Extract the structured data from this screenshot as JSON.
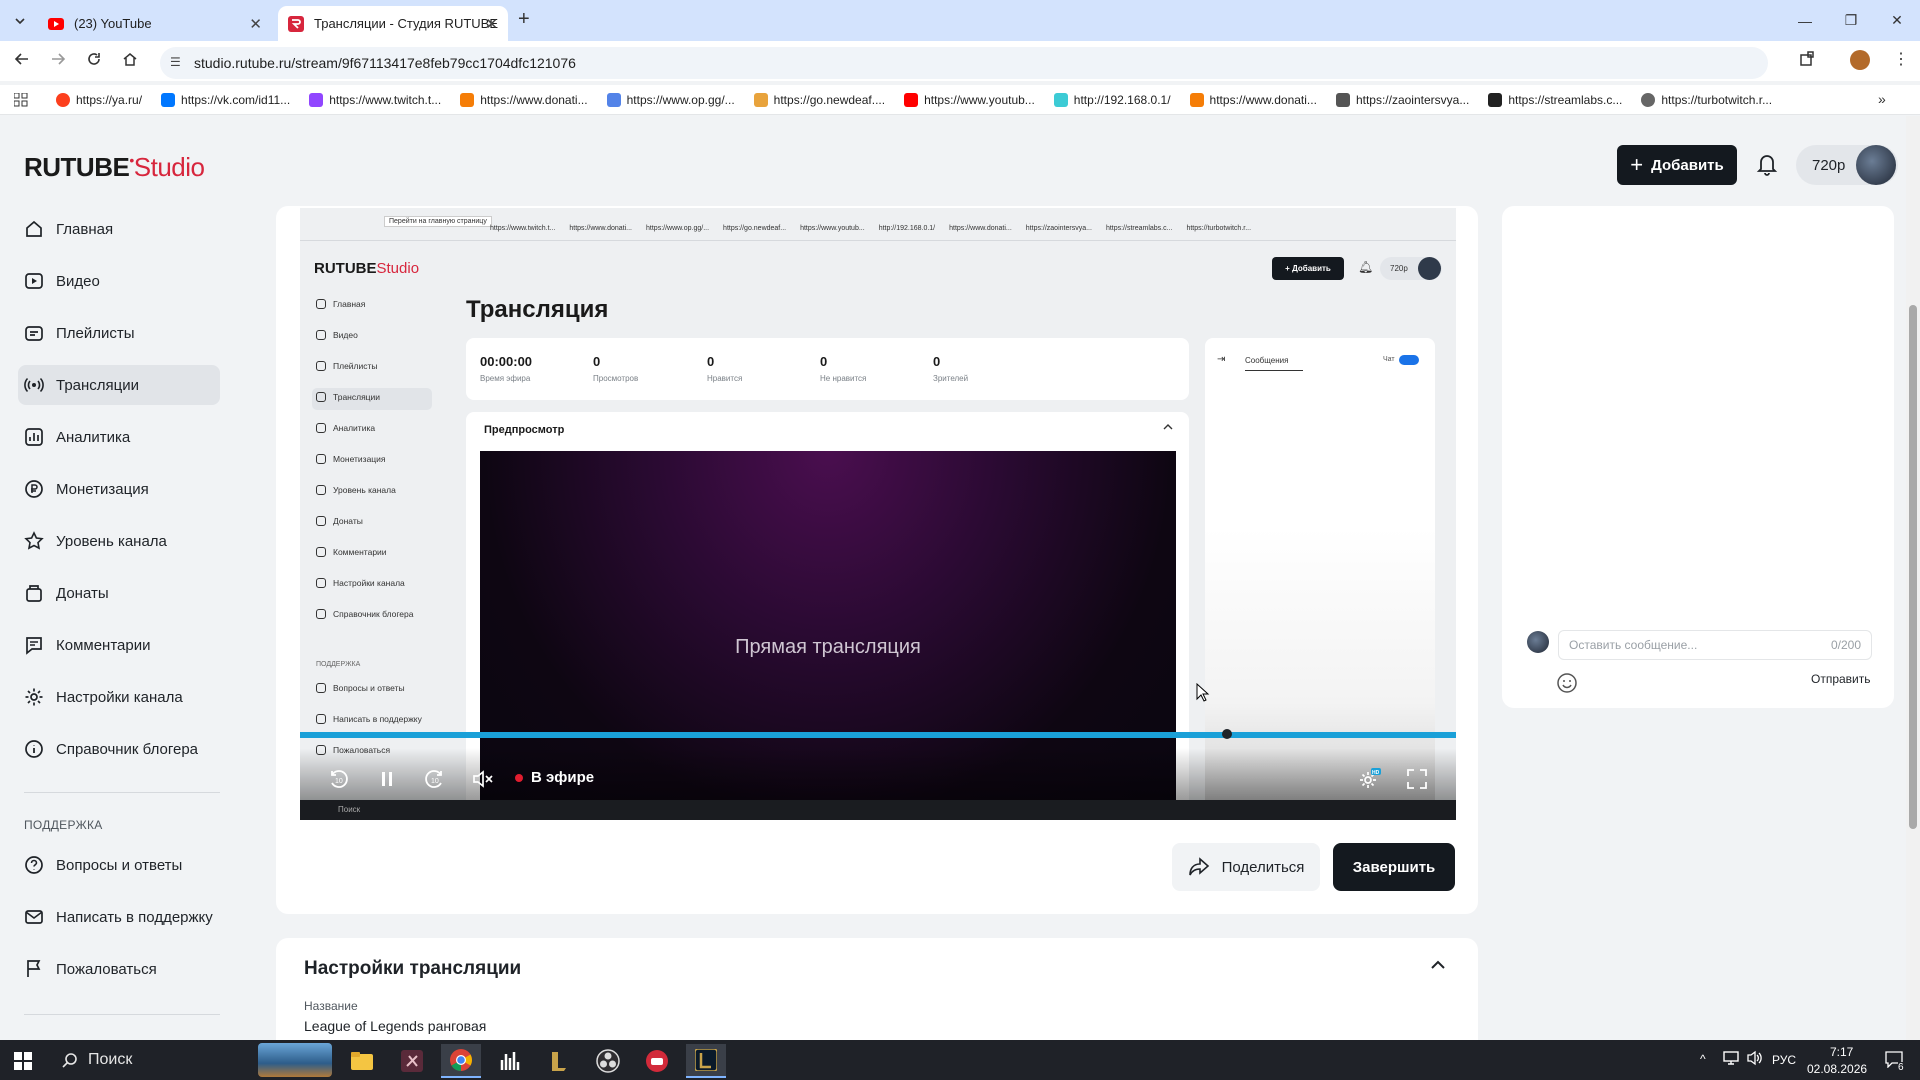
{
  "browser": {
    "tabs": [
      {
        "title": "(23) YouTube",
        "active": false
      },
      {
        "title": "Трансляции - Студия RUTUBE",
        "active": true
      }
    ],
    "url": "studio.rutube.ru/stream/9f67113417e8feb79cc1704dfc121076",
    "bookmarks": [
      "https://ya.ru/",
      "https://vk.com/id11...",
      "https://www.twitch.t...",
      "https://www.donati...",
      "https://www.op.gg/...",
      "https://go.newdeaf....",
      "https://www.youtub...",
      "http://192.168.0.1/",
      "https://www.donati...",
      "https://zaointersvya...",
      "https://streamlabs.c...",
      "https://turbotwitch.r..."
    ]
  },
  "header": {
    "logo_main": "RUTUBE",
    "logo_sub": "Studio",
    "add_button": "Добавить",
    "quality": "720p"
  },
  "sidebar": {
    "items": [
      {
        "label": "Главная",
        "icon": "home-icon"
      },
      {
        "label": "Видео",
        "icon": "video-icon"
      },
      {
        "label": "Плейлисты",
        "icon": "playlist-icon"
      },
      {
        "label": "Трансляции",
        "icon": "broadcast-icon",
        "active": true
      },
      {
        "label": "Аналитика",
        "icon": "analytics-icon"
      },
      {
        "label": "Монетизация",
        "icon": "monetization-icon"
      },
      {
        "label": "Уровень канала",
        "icon": "star-icon"
      },
      {
        "label": "Донаты",
        "icon": "donate-icon"
      },
      {
        "label": "Комментарии",
        "icon": "comment-icon"
      },
      {
        "label": "Настройки канала",
        "icon": "gear-icon"
      },
      {
        "label": "Справочник блогера",
        "icon": "info-icon"
      }
    ],
    "support_title": "ПОДДЕРЖКА",
    "support_items": [
      {
        "label": "Вопросы и ответы",
        "icon": "question-icon"
      },
      {
        "label": "Написать в поддержку",
        "icon": "mail-icon"
      },
      {
        "label": "Пожаловаться",
        "icon": "flag-icon"
      }
    ]
  },
  "player": {
    "status": "В эфире",
    "progress": 1.0,
    "nested": {
      "tooltip": "Перейти на главную страницу",
      "logo_main": "RUTUBE",
      "logo_sub": "Studio",
      "add_button": "Добавить",
      "quality": "720p",
      "page_title": "Трансляция",
      "sidebar": [
        "Главная",
        "Видео",
        "Плейлисты",
        "Трансляции",
        "Аналитика",
        "Монетизация",
        "Уровень канала",
        "Донаты",
        "Комментарии",
        "Настройки канала",
        "Справочник блогера"
      ],
      "support_title": "ПОДДЕРЖКА",
      "support_items": [
        "Вопросы и ответы",
        "Написать в поддержку",
        "Пожаловаться"
      ],
      "stats": [
        {
          "value": "00:00:00",
          "label": "Время эфира"
        },
        {
          "value": "0",
          "label": "Просмотров"
        },
        {
          "value": "0",
          "label": "Нравится"
        },
        {
          "value": "0",
          "label": "Не нравится"
        },
        {
          "value": "0",
          "label": "Зрителей"
        }
      ],
      "preview_label": "Предпросмотр",
      "live_text": "Прямая трансляция",
      "chat_tab": "Сообщения",
      "chat_toggle_label": "Чат",
      "bookmarks": [
        "https://www.twitch.t...",
        "https://www.donati...",
        "https://www.op.gg/...",
        "https://go.newdeaf...",
        "https://www.youtub...",
        "http://192.168.0.1/",
        "https://www.donati...",
        "https://zaointersvya...",
        "https://streamlabs.c...",
        "https://turbotwitch.r..."
      ],
      "taskbar_search": "Поиск"
    }
  },
  "actions": {
    "share": "Поделиться",
    "finish": "Завершить"
  },
  "settings": {
    "title": "Настройки трансляции",
    "name_label": "Название",
    "name_value": "League of Legends ранговая"
  },
  "chat": {
    "placeholder": "Оставить сообщение...",
    "counter": "0/200",
    "send": "Отправить"
  },
  "taskbar": {
    "search": "Поиск",
    "lang": "РУС",
    "time": "7:17",
    "date": "02.08.2026",
    "notifications": "6"
  },
  "colors": {
    "accent_red": "#d7263d",
    "dark_button": "#14191f",
    "progress_blue": "#1aa0d8"
  }
}
